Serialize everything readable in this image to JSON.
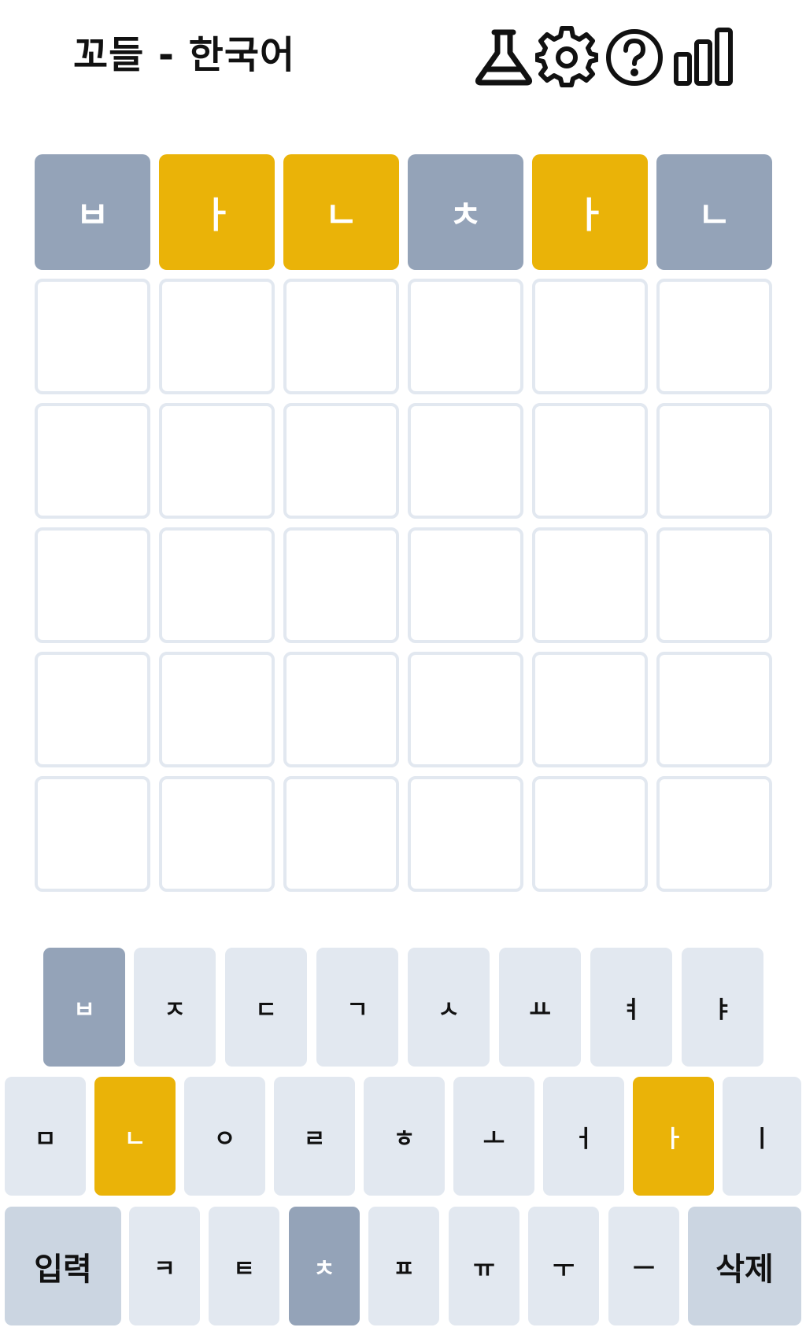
{
  "header": {
    "title": "꼬들 - 한국어",
    "icons": [
      "flask-icon",
      "gear-icon",
      "help-circle-icon",
      "stats-bars-icon"
    ]
  },
  "colors": {
    "absent": "#94a3b8",
    "present": "#eab308",
    "empty_border": "#e2e8f0",
    "key_default": "#e2e8f0",
    "key_wide": "#cbd5e1"
  },
  "board": {
    "rows": [
      [
        {
          "letter": "ㅂ",
          "state": "absent"
        },
        {
          "letter": "ㅏ",
          "state": "present"
        },
        {
          "letter": "ㄴ",
          "state": "present"
        },
        {
          "letter": "ㅊ",
          "state": "absent"
        },
        {
          "letter": "ㅏ",
          "state": "present"
        },
        {
          "letter": "ㄴ",
          "state": "absent"
        }
      ],
      [
        {
          "letter": "",
          "state": "empty"
        },
        {
          "letter": "",
          "state": "empty"
        },
        {
          "letter": "",
          "state": "empty"
        },
        {
          "letter": "",
          "state": "empty"
        },
        {
          "letter": "",
          "state": "empty"
        },
        {
          "letter": "",
          "state": "empty"
        }
      ],
      [
        {
          "letter": "",
          "state": "empty"
        },
        {
          "letter": "",
          "state": "empty"
        },
        {
          "letter": "",
          "state": "empty"
        },
        {
          "letter": "",
          "state": "empty"
        },
        {
          "letter": "",
          "state": "empty"
        },
        {
          "letter": "",
          "state": "empty"
        }
      ],
      [
        {
          "letter": "",
          "state": "empty"
        },
        {
          "letter": "",
          "state": "empty"
        },
        {
          "letter": "",
          "state": "empty"
        },
        {
          "letter": "",
          "state": "empty"
        },
        {
          "letter": "",
          "state": "empty"
        },
        {
          "letter": "",
          "state": "empty"
        }
      ],
      [
        {
          "letter": "",
          "state": "empty"
        },
        {
          "letter": "",
          "state": "empty"
        },
        {
          "letter": "",
          "state": "empty"
        },
        {
          "letter": "",
          "state": "empty"
        },
        {
          "letter": "",
          "state": "empty"
        },
        {
          "letter": "",
          "state": "empty"
        }
      ],
      [
        {
          "letter": "",
          "state": "empty"
        },
        {
          "letter": "",
          "state": "empty"
        },
        {
          "letter": "",
          "state": "empty"
        },
        {
          "letter": "",
          "state": "empty"
        },
        {
          "letter": "",
          "state": "empty"
        },
        {
          "letter": "",
          "state": "empty"
        }
      ]
    ]
  },
  "keyboard": {
    "rows": [
      [
        {
          "label": "ㅂ",
          "state": "absent"
        },
        {
          "label": "ㅈ",
          "state": "default"
        },
        {
          "label": "ㄷ",
          "state": "default"
        },
        {
          "label": "ㄱ",
          "state": "default"
        },
        {
          "label": "ㅅ",
          "state": "default"
        },
        {
          "label": "ㅛ",
          "state": "default"
        },
        {
          "label": "ㅕ",
          "state": "default"
        },
        {
          "label": "ㅑ",
          "state": "default"
        }
      ],
      [
        {
          "label": "ㅁ",
          "state": "default"
        },
        {
          "label": "ㄴ",
          "state": "present"
        },
        {
          "label": "ㅇ",
          "state": "default"
        },
        {
          "label": "ㄹ",
          "state": "default"
        },
        {
          "label": "ㅎ",
          "state": "default"
        },
        {
          "label": "ㅗ",
          "state": "default"
        },
        {
          "label": "ㅓ",
          "state": "default"
        },
        {
          "label": "ㅏ",
          "state": "present"
        },
        {
          "label": "ㅣ",
          "state": "default"
        }
      ],
      [
        {
          "label": "입력",
          "state": "wide"
        },
        {
          "label": "ㅋ",
          "state": "default"
        },
        {
          "label": "ㅌ",
          "state": "default"
        },
        {
          "label": "ㅊ",
          "state": "absent"
        },
        {
          "label": "ㅍ",
          "state": "default"
        },
        {
          "label": "ㅠ",
          "state": "default"
        },
        {
          "label": "ㅜ",
          "state": "default"
        },
        {
          "label": "ㅡ",
          "state": "default"
        },
        {
          "label": "삭제",
          "state": "wide"
        }
      ]
    ]
  }
}
